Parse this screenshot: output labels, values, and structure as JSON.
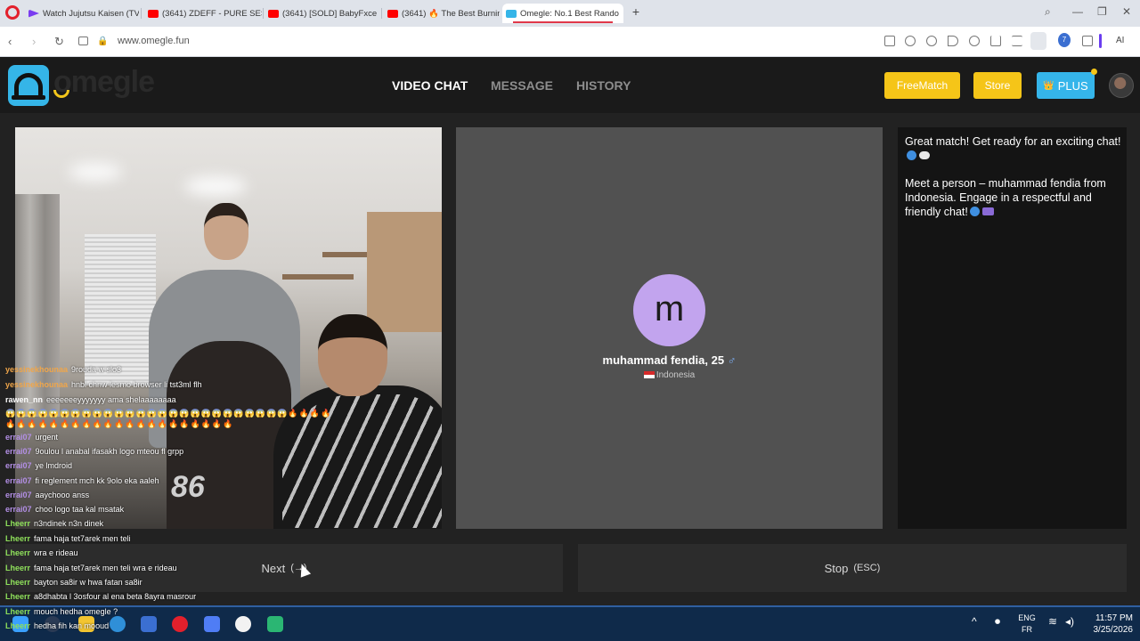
{
  "browser": {
    "tabs": [
      {
        "label": "Watch Jujutsu Kaisen (TV)",
        "color": "#7a3cf0"
      },
      {
        "label": "(3641) ZDEFF - PURE SESS",
        "color": "#ff0000"
      },
      {
        "label": "(3641) [SOLD] BabyFxce E",
        "color": "#ff0000"
      },
      {
        "label": "(3641) 🔥 The Best Burnin",
        "color": "#ff0000"
      },
      {
        "label": "Omegle: No.1 Best Rando",
        "color": "#35b5e8"
      }
    ],
    "url": "www.omegle.fun",
    "ai_label": "AI",
    "badge_count": "7"
  },
  "header": {
    "logo_text": "omegle",
    "nav": [
      "VIDEO CHAT",
      "MESSAGE",
      "HISTORY"
    ],
    "freematch_label": "FreeMatch",
    "store_label": "Store",
    "plus_label": "PLUS",
    "plus_icon": "👑"
  },
  "remote": {
    "avatar_letter": "m",
    "name": "muhammad fendia, 25",
    "gender_symbol": "♂",
    "country": "Indonesia"
  },
  "system_messages": [
    "Great match! Get ready for an exciting chat!",
    "Meet a person – muhammad fendia from Indonesia. Engage in a respectful and friendly chat!"
  ],
  "chat": [
    {
      "user": "yessinekhounaa",
      "text": "9rouda w slo3"
    },
    {
      "user": "yessinekhounaa",
      "text": "hnbl chnw lesmo browser li tst3ml flh"
    },
    {
      "user": "rawen_nn",
      "text": "eeeeeeeyyyyyyy ama shelaaaaaaaa"
    },
    {
      "user": "errai07",
      "text": "urgent"
    },
    {
      "user": "errai07",
      "text": "9oulou l anabal ifasakh logo mteou fl grpp"
    },
    {
      "user": "errai07",
      "text": "ye lmdroid"
    },
    {
      "user": "errai07",
      "text": "fi reglement mch kk 9olo eka aaleh"
    },
    {
      "user": "errai07",
      "text": "aaychooo anss"
    },
    {
      "user": "errai07",
      "text": "choo logo taa kal msatak"
    },
    {
      "user": "Lheerr",
      "text": "n3ndinek n3n dinek"
    },
    {
      "user": "Lheerr",
      "text": "fama haja tet7arek men teli"
    },
    {
      "user": "Lheerr",
      "text": "wra e rideau"
    },
    {
      "user": "Lheerr",
      "text": "fama haja tet7arek men teli wra e rideau"
    },
    {
      "user": "Lheerr",
      "text": "bayton sa8ir w hwa fatan sa8ir"
    },
    {
      "user": "Lheerr",
      "text": "a8dhabta l 3osfour al ena beta 8ayra masrour"
    },
    {
      "user": "Lheerr",
      "text": "mouch hedha omegle ?"
    },
    {
      "user": "Lheerr",
      "text": "hedha fih kan mooud"
    }
  ],
  "emoji_rows": [
    "😱😱😱😱😱😱😱😱😱😱😱😱😱😱😱😱😱😱😱😱😱😱😱😱😱😱🔥🔥🔥🔥",
    "🔥🔥🔥🔥🔥🔥🔥🔥🔥🔥🔥🔥🔥🔥🔥🔥🔥🔥🔥🔥🔥"
  ],
  "jersey_number": "86",
  "controls": {
    "next_label": "Next",
    "next_key": "(→)",
    "stop_label": "Stop",
    "stop_key": "(ESC)"
  },
  "taskbar": {
    "lang_line1": "ENG",
    "lang_line2": "FR",
    "time": "11:57 PM",
    "date": "3/25/2026"
  },
  "colors": {
    "accent_blue": "#35b5e8",
    "accent_yellow": "#f5c518",
    "remote_avatar": "#c2a4ee"
  }
}
